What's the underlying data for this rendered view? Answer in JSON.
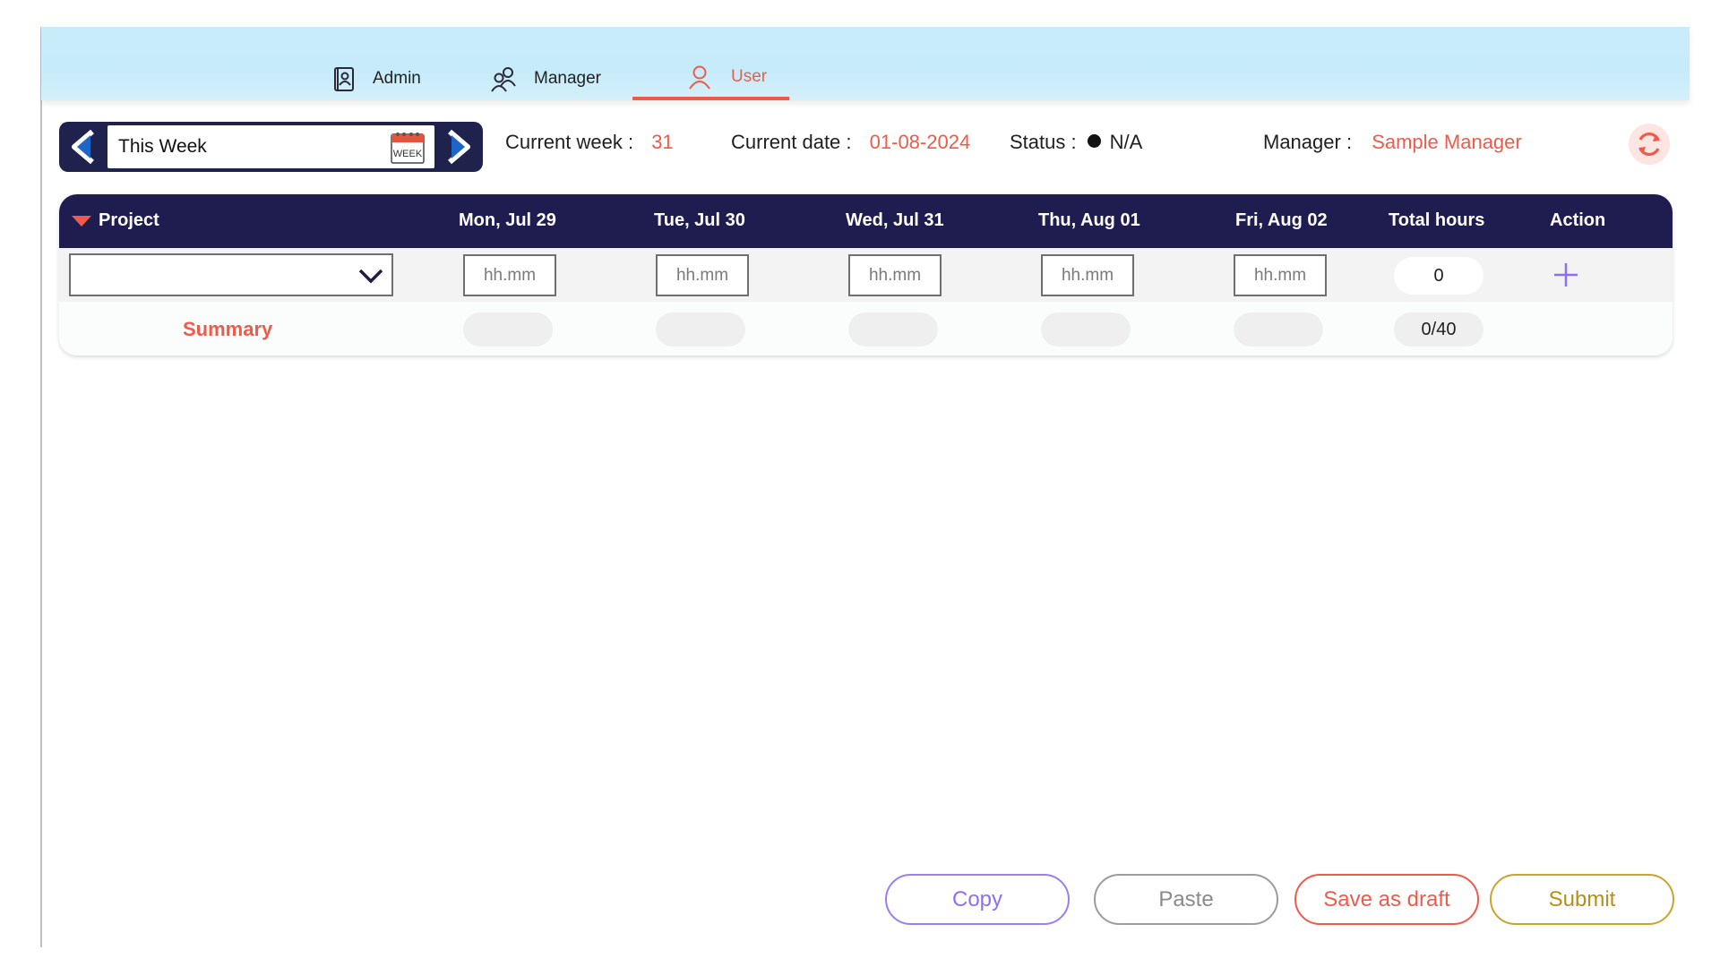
{
  "nav": {
    "tabs": [
      {
        "label": "Admin",
        "icon": "admin-badge-icon",
        "active": false
      },
      {
        "label": "Manager",
        "icon": "people-icon",
        "active": false
      },
      {
        "label": "User",
        "icon": "user-icon",
        "active": true
      }
    ]
  },
  "week_selector": {
    "value": "This Week",
    "calendar_icon_text": "WEEK"
  },
  "info": {
    "current_week_label": "Current week :",
    "current_week_value": "31",
    "current_date_label": "Current date :",
    "current_date_value": "01-08-2024",
    "status_label": "Status :",
    "status_value": "N/A",
    "manager_label": "Manager :",
    "manager_value": "Sample Manager"
  },
  "table": {
    "columns": [
      "Project",
      "Mon, Jul 29",
      "Tue, Jul 30",
      "Wed, Jul 31",
      "Thu, Aug 01",
      "Fri, Aug 02",
      "Total hours",
      "Action"
    ],
    "hour_placeholder": "hh.mm",
    "row_total": "0",
    "summary_label": "Summary",
    "summary_total": "0/40"
  },
  "buttons": {
    "copy": "Copy",
    "paste": "Paste",
    "save_draft": "Save as draft",
    "submit": "Submit"
  },
  "colors": {
    "accent_red": "#f05a4a",
    "header_navy": "#1f1d4f",
    "nav_bg": "#c9ecfa",
    "copy_purple": "#8f6ff0",
    "submit_gold": "#b58f19"
  }
}
